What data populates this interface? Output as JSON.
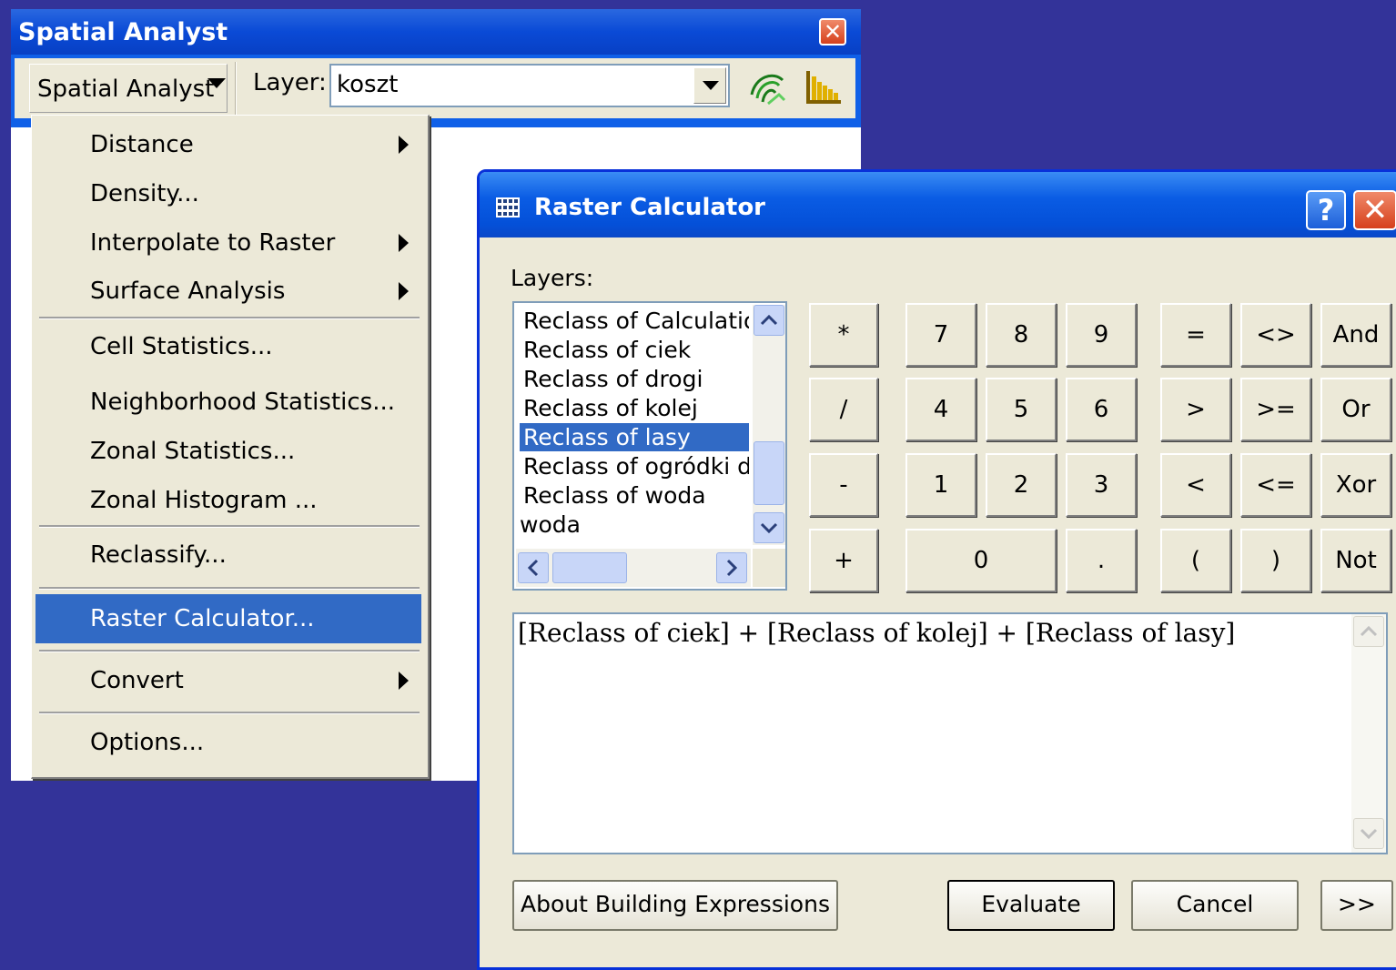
{
  "spatial_analyst_window": {
    "title": "Spatial Analyst",
    "close_label": "✕",
    "toolbar": {
      "menu_button_label": "Spatial Analyst",
      "layer_label": "Layer:",
      "layer_value": "koszt",
      "icons": [
        "contour-icon",
        "histogram-icon"
      ]
    }
  },
  "menu": {
    "items": [
      {
        "label": "Distance",
        "submenu": true
      },
      {
        "label": "Density...",
        "submenu": false
      },
      {
        "label": "Interpolate to Raster",
        "submenu": true
      },
      {
        "label": "Surface Analysis",
        "submenu": true
      },
      {
        "label": "Cell Statistics...",
        "submenu": false
      },
      {
        "label": "Neighborhood Statistics...",
        "submenu": false
      },
      {
        "label": "Zonal Statistics...",
        "submenu": false
      },
      {
        "label": "Zonal Histogram ...",
        "submenu": false
      },
      {
        "label": "Reclassify...",
        "submenu": false
      },
      {
        "label": "Raster Calculator...",
        "submenu": false,
        "selected": true
      },
      {
        "label": "Convert",
        "submenu": true
      },
      {
        "label": "Options...",
        "submenu": false
      }
    ]
  },
  "raster_calculator": {
    "title": "Raster Calculator",
    "help_label": "?",
    "close_label": "✕",
    "layers_label": "Layers:",
    "layers": [
      "Reclass of Calculatior",
      "Reclass of ciek",
      "Reclass of drogi",
      "Reclass of kolej",
      "Reclass of lasy",
      "Reclass of ogródki dz",
      "Reclass of woda",
      "woda"
    ],
    "selected_layer": "Reclass of lasy",
    "operator_buttons": [
      "*",
      "/",
      "-",
      "+"
    ],
    "digit_buttons": [
      "7",
      "8",
      "9",
      "4",
      "5",
      "6",
      "1",
      "2",
      "3",
      "0",
      "."
    ],
    "comparison_buttons": [
      "=",
      "<>",
      ">",
      ">=",
      "<",
      "<=",
      "(",
      ")"
    ],
    "logical_buttons": [
      "And",
      "Or",
      "Xor",
      "Not"
    ],
    "expression": "[Reclass of ciek]  +  [Reclass of kolej]  +  [Reclass of lasy]",
    "buttons": {
      "about": "About Building Expressions",
      "evaluate": "Evaluate",
      "cancel": "Cancel",
      "more": ">>"
    }
  },
  "colors": {
    "desktop": "#333399",
    "xp_title_blue": "#0a5ce4",
    "menu_highlight": "#316ac5",
    "dialog_face": "#ece9d8"
  }
}
